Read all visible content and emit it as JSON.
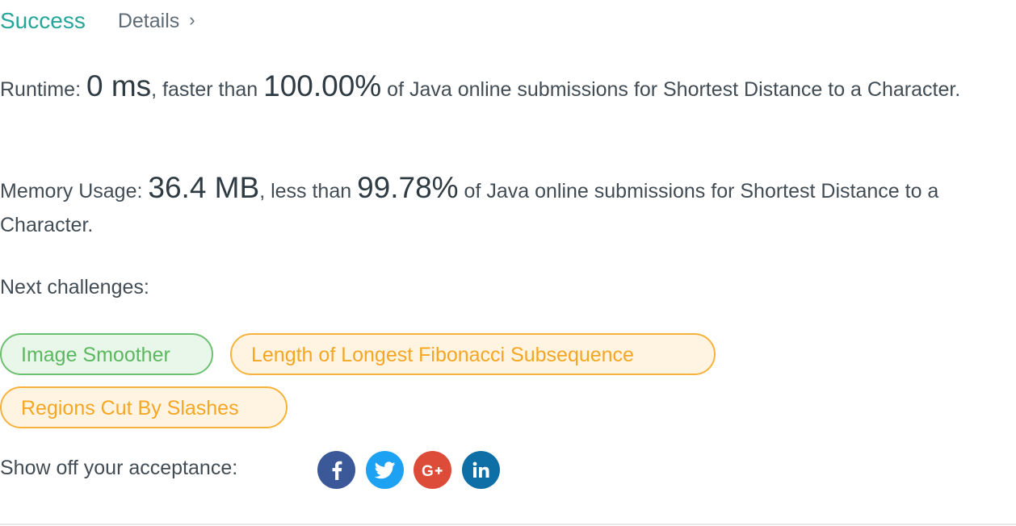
{
  "header": {
    "status": "Success",
    "details_label": "Details",
    "details_chevron": "›"
  },
  "runtime": {
    "label": "Runtime: ",
    "value": "0 ms",
    "middle": ", faster than ",
    "percent": "100.00%",
    "suffix": " of Java online submissions for Shortest Distance to a Character."
  },
  "memory": {
    "label": "Memory Usage: ",
    "value": "36.4 MB",
    "middle": ", less than ",
    "percent": "99.78%",
    "suffix": " of Java online submissions for Shortest Distance to a Character."
  },
  "next": {
    "label": "Next challenges:",
    "challenges": [
      {
        "title": "Image Smoother",
        "difficulty_color": "#5cb860"
      },
      {
        "title": "Length of Longest Fibonacci Subsequence",
        "difficulty_color": "#f5a623"
      },
      {
        "title": "Regions Cut By Slashes",
        "difficulty_color": "#f5a623"
      }
    ]
  },
  "share": {
    "label": "Show off your acceptance:",
    "icons": [
      "facebook-icon",
      "twitter-icon",
      "google-plus-icon",
      "linkedin-icon"
    ]
  },
  "colors": {
    "success": "#26a69a",
    "facebook": "#3b5998",
    "twitter": "#1da1f2",
    "google_plus": "#dd4b39",
    "linkedin": "#0e6fa6"
  }
}
